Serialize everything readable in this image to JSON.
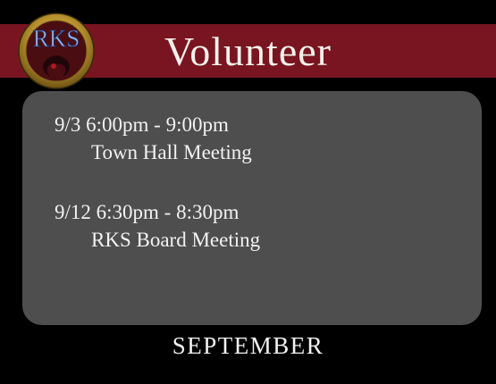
{
  "header": {
    "title": "Volunteer",
    "logo_text": "RKS",
    "banner_color": "#781520"
  },
  "events": [
    {
      "time": "9/3 6:00pm - 9:00pm",
      "name": "Town Hall Meeting"
    },
    {
      "time": "9/12 6:30pm - 8:30pm",
      "name": "RKS Board Meeting"
    }
  ],
  "footer": {
    "month": "SEPTEMBER"
  },
  "colors": {
    "background": "#000000",
    "panel": "#4e4e4e",
    "text": "#f2f2f2",
    "logo_gold": "#b8922e",
    "logo_text": "#9fb6e6"
  }
}
